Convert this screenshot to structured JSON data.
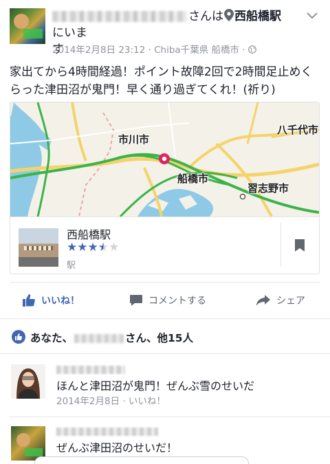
{
  "post": {
    "author_suffix": "さんは",
    "place": "西船橋駅",
    "place_suffix": "にいま",
    "wrap": "す",
    "date": "2014年2月8日 23:12",
    "location": "Chiba千葉県 船橋市",
    "sep": "·",
    "text": "家出てから4時間経過！ポイント故障2回で2時間足止めくらった津田沼が鬼門！早く通り過ぎてくれ！(祈り)"
  },
  "map": {
    "labels": [
      "市川市",
      "八千代市",
      "船橋市",
      "習志野市"
    ]
  },
  "place_card": {
    "name": "西船橋駅",
    "rating": 3.5,
    "stars": [
      "★",
      "★",
      "★",
      "★",
      "★"
    ],
    "type": "駅"
  },
  "actions": {
    "like": "いいね！",
    "comment": "コメントする",
    "share": "シェア"
  },
  "likes": {
    "prefix": "あなた、",
    "suffix": "さん、他15人"
  },
  "comments": [
    {
      "text": "ほんと津田沼が鬼門！ぜんぶ雪のせいだ",
      "meta": "2014年2月8日 · いいね！"
    },
    {
      "text": "ぜんぶ津田沼のせいだ！"
    }
  ],
  "colors": {
    "accent": "#4267b2",
    "pin": "#e0245e",
    "road_green": "#3cb34a",
    "road_yellow": "#f5d36a",
    "water": "#7fc3e0"
  },
  "icons": [
    "location-pin-icon",
    "globe-icon",
    "chevron-down-icon",
    "bookmark-icon",
    "thumbs-up-icon",
    "comment-icon",
    "share-icon"
  ]
}
